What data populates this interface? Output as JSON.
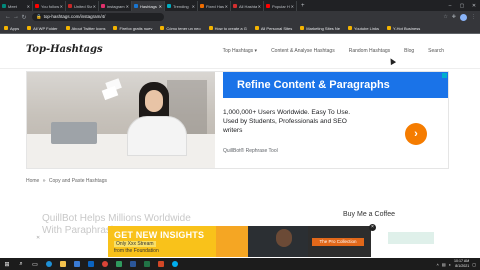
{
  "browser": {
    "tabs": [
      {
        "label": "Meet",
        "color": "#00897b",
        "active": false
      },
      {
        "label": "You follow",
        "color": "#ff0000",
        "active": false
      },
      {
        "label": "United Sta",
        "color": "#c62828",
        "active": false
      },
      {
        "label": "instagram",
        "color": "#e1306c",
        "active": false
      },
      {
        "label": "Hashtags",
        "color": "#1976d2",
        "active": true
      },
      {
        "label": "Trending",
        "color": "#00acc1",
        "active": false
      },
      {
        "label": "Fixed Hash",
        "color": "#ef6c00",
        "active": false
      },
      {
        "label": "All Hashta",
        "color": "#d32f2f",
        "active": false
      },
      {
        "label": "Popular H",
        "color": "#ff0000",
        "active": false
      }
    ],
    "new_tab": "+",
    "url": "top-hashtags.com/instagram/4/",
    "bookmarks": [
      "Apps",
      "All WP Folder",
      "About Twitter Icons",
      "Firefox gratis nuev",
      "Cómo tener un neo",
      "How to create a G",
      "All Personal Sites",
      "Marketing Sites Ne",
      "Youtube Links",
      "Y-Hot Business"
    ]
  },
  "site": {
    "logo": "Top-Hashtags",
    "nav": [
      "Top Hashtags ▾",
      "Content & Analyse Hashtags",
      "Random Hashtags",
      "Blog",
      "Search"
    ]
  },
  "hero_ad": {
    "title": "Refine Content & Paragraphs",
    "body": "1,000,000+ Users Worldwide. Easy To Use. Used by Students, Professionals and SEO writers",
    "sponsor": "QuillBot® Rephrase Tool",
    "go_icon": "›"
  },
  "breadcrumb": {
    "home": "Home",
    "sep": "»",
    "current": "Copy and Paste Hashtags"
  },
  "article": {
    "title": "QuillBot Helps Millions Worldwide With Paraphrasing. It's Free"
  },
  "sidebar": {
    "title": "Buy Me a Coffee"
  },
  "banner_ad": {
    "headline": "GET NEW INSIGHTS",
    "line1": "Only Xxx Stream",
    "line2": "from the Foundation",
    "tag": "The Pro Collection",
    "close": "×"
  },
  "taskbar": {
    "start_icon": "windows-icon",
    "time": "10:17 AM",
    "date": "8/1/2021"
  },
  "colors": {
    "accent_blue": "#1a73e8",
    "cta_orange": "#f57c00",
    "banner_yellow": "#f9c21a"
  }
}
